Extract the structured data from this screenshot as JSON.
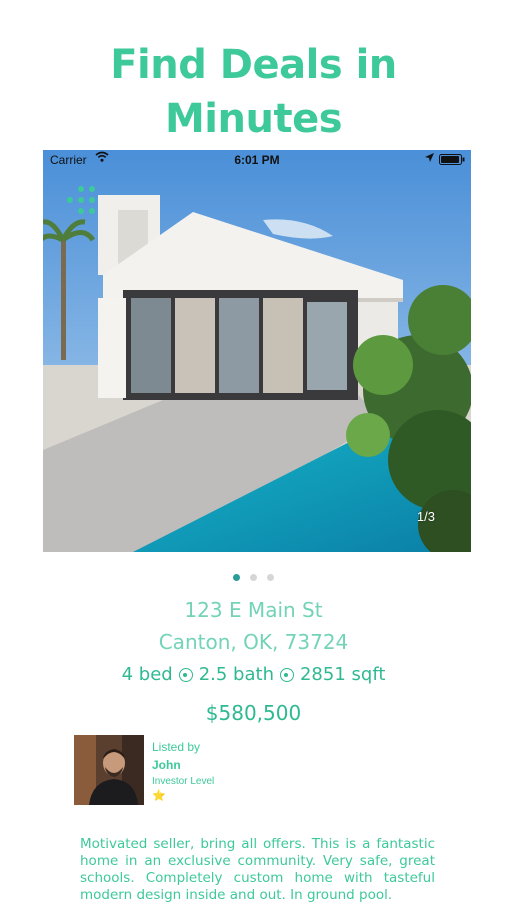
{
  "headline": {
    "line1": "Find Deals in",
    "line2": "Minutes"
  },
  "status_bar": {
    "carrier": "Carrier",
    "time": "6:01 PM"
  },
  "photo": {
    "counter": "1/3",
    "current_index": 1,
    "total": 3
  },
  "listing": {
    "address_line1": "123 E Main St",
    "address_line2": "Canton, OK, 73724",
    "beds": "4 bed",
    "baths": "2.5 bath",
    "sqft": "2851 sqft",
    "price": "$580,500"
  },
  "lister": {
    "listed_by_label": "Listed by",
    "name": "John",
    "level": "Investor Level",
    "star": "⭐"
  },
  "description": "Motivated seller, bring all offers. This is a fantastic home in an exclusive community. Very safe, great schools. Completely custom home with tasteful modern design inside and out. In ground pool.",
  "colors": {
    "brand_green": "#3ec99a",
    "active_dot": "#2b9c9a"
  }
}
